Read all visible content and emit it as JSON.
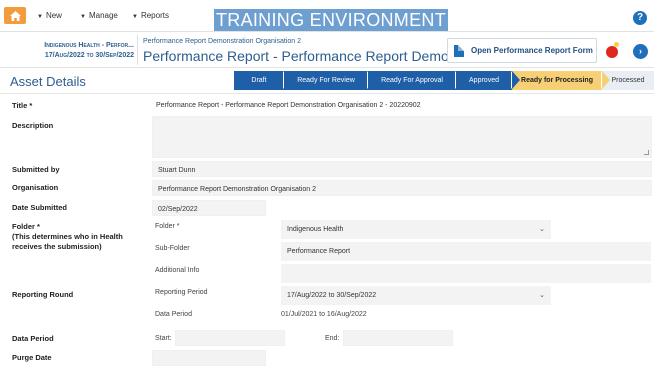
{
  "topbar": {
    "new_label": "New",
    "manage_label": "Manage",
    "reports_label": "Reports",
    "training_banner": "TRAINING ENVIRONMENT"
  },
  "header": {
    "breadcrumb_line1": "Indigenous Health - Perfor...",
    "breadcrumb_line2": "17/Aug/2022 to 30/Sep/2022",
    "org_name": "Performance Report Demonstration Organisation 2",
    "title": "Performance Report - Performance Report Demonstrati...",
    "open_button": "Open Performance Report Form"
  },
  "asset": {
    "heading": "Asset Details",
    "steps": [
      "Draft",
      "Ready For Review",
      "Ready For Approval",
      "Approved",
      "Ready for Processing",
      "Processed"
    ],
    "active_step": "Ready for Processing"
  },
  "form": {
    "title_label": "Title *",
    "title_value": "Performance Report - Performance Report Demonstration Organisation 2 - 20220902",
    "description_label": "Description",
    "description_value": "",
    "submitted_by_label": "Submitted by",
    "submitted_by_value": "Stuart Dunn",
    "organisation_label": "Organisation",
    "organisation_value": "Performance Report Demonstration Organisation 2",
    "date_submitted_label": "Date Submitted",
    "date_submitted_value": "02/Sep/2022",
    "folder_label": "Folder *",
    "folder_note": "(This determines who in Health receives the submission)",
    "folder_sub_label": "Folder *",
    "folder_value": "Indigenous Health",
    "subfolder_label": "Sub-Folder",
    "subfolder_value": "Performance Report",
    "additional_info_label": "Additional Info",
    "additional_info_value": "",
    "reporting_round_label": "Reporting Round",
    "reporting_period_label": "Reporting Period",
    "reporting_period_value": "17/Aug/2022 to 30/Sep/2022",
    "data_period_sub_label": "Data Period",
    "data_period_sub_value": "01/Jul/2021 to 16/Aug/2022",
    "data_period_label": "Data Period",
    "start_label": "Start:",
    "end_label": "End:",
    "purge_date_label": "Purge Date"
  }
}
